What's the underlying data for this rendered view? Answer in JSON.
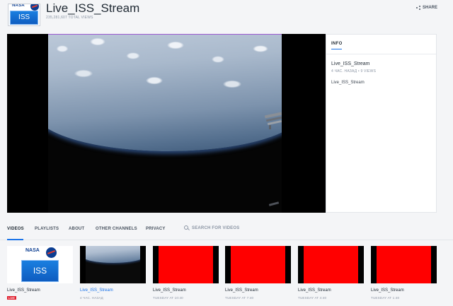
{
  "header": {
    "logo_nasa": "NASA",
    "logo_iss": "ISS",
    "channel_title": "Live_ISS_Stream",
    "total_views": "235,281,607 TOTAL VIEWS",
    "share_label": "SHARE",
    "share_icon": "share-icon"
  },
  "info": {
    "tab_label": "INFO",
    "title": "Live_ISS_Stream",
    "meta": "4 ЧАС. НАЗАД • 9 VIEWS",
    "description": "Live_ISS_Stream"
  },
  "tabs": [
    {
      "label": "VIDEOS"
    },
    {
      "label": "PLAYLISTS"
    },
    {
      "label": "ABOUT"
    },
    {
      "label": "OTHER CHANNELS"
    },
    {
      "label": "PRIVACY"
    }
  ],
  "search": {
    "label": "SEARCH FOR VIDEOS",
    "icon": "search-icon"
  },
  "videos": [
    {
      "title": "Live_ISS_Stream",
      "badge": "LIVE",
      "thumb": "nasa-logo",
      "thumb_nasa": "NASA",
      "thumb_iss": "ISS"
    },
    {
      "title": "Live_ISS_Stream",
      "meta": "4 ЧАС. НАЗАД",
      "thumb": "earth"
    },
    {
      "title": "Live_ISS_Stream",
      "meta": "TUESDAY AT 10:40",
      "thumb": "red"
    },
    {
      "title": "Live_ISS_Stream",
      "meta": "TUESDAY AT 7:40",
      "thumb": "red"
    },
    {
      "title": "Live_ISS_Stream",
      "meta": "TUESDAY AT 4:40",
      "thumb": "red"
    },
    {
      "title": "Live_ISS_Stream",
      "meta": "TUESDAY AT 1:40",
      "thumb": "red"
    }
  ],
  "colors": {
    "accent": "#1a73e8",
    "live": "#e0202f",
    "thumb_red": "#ff0000"
  }
}
